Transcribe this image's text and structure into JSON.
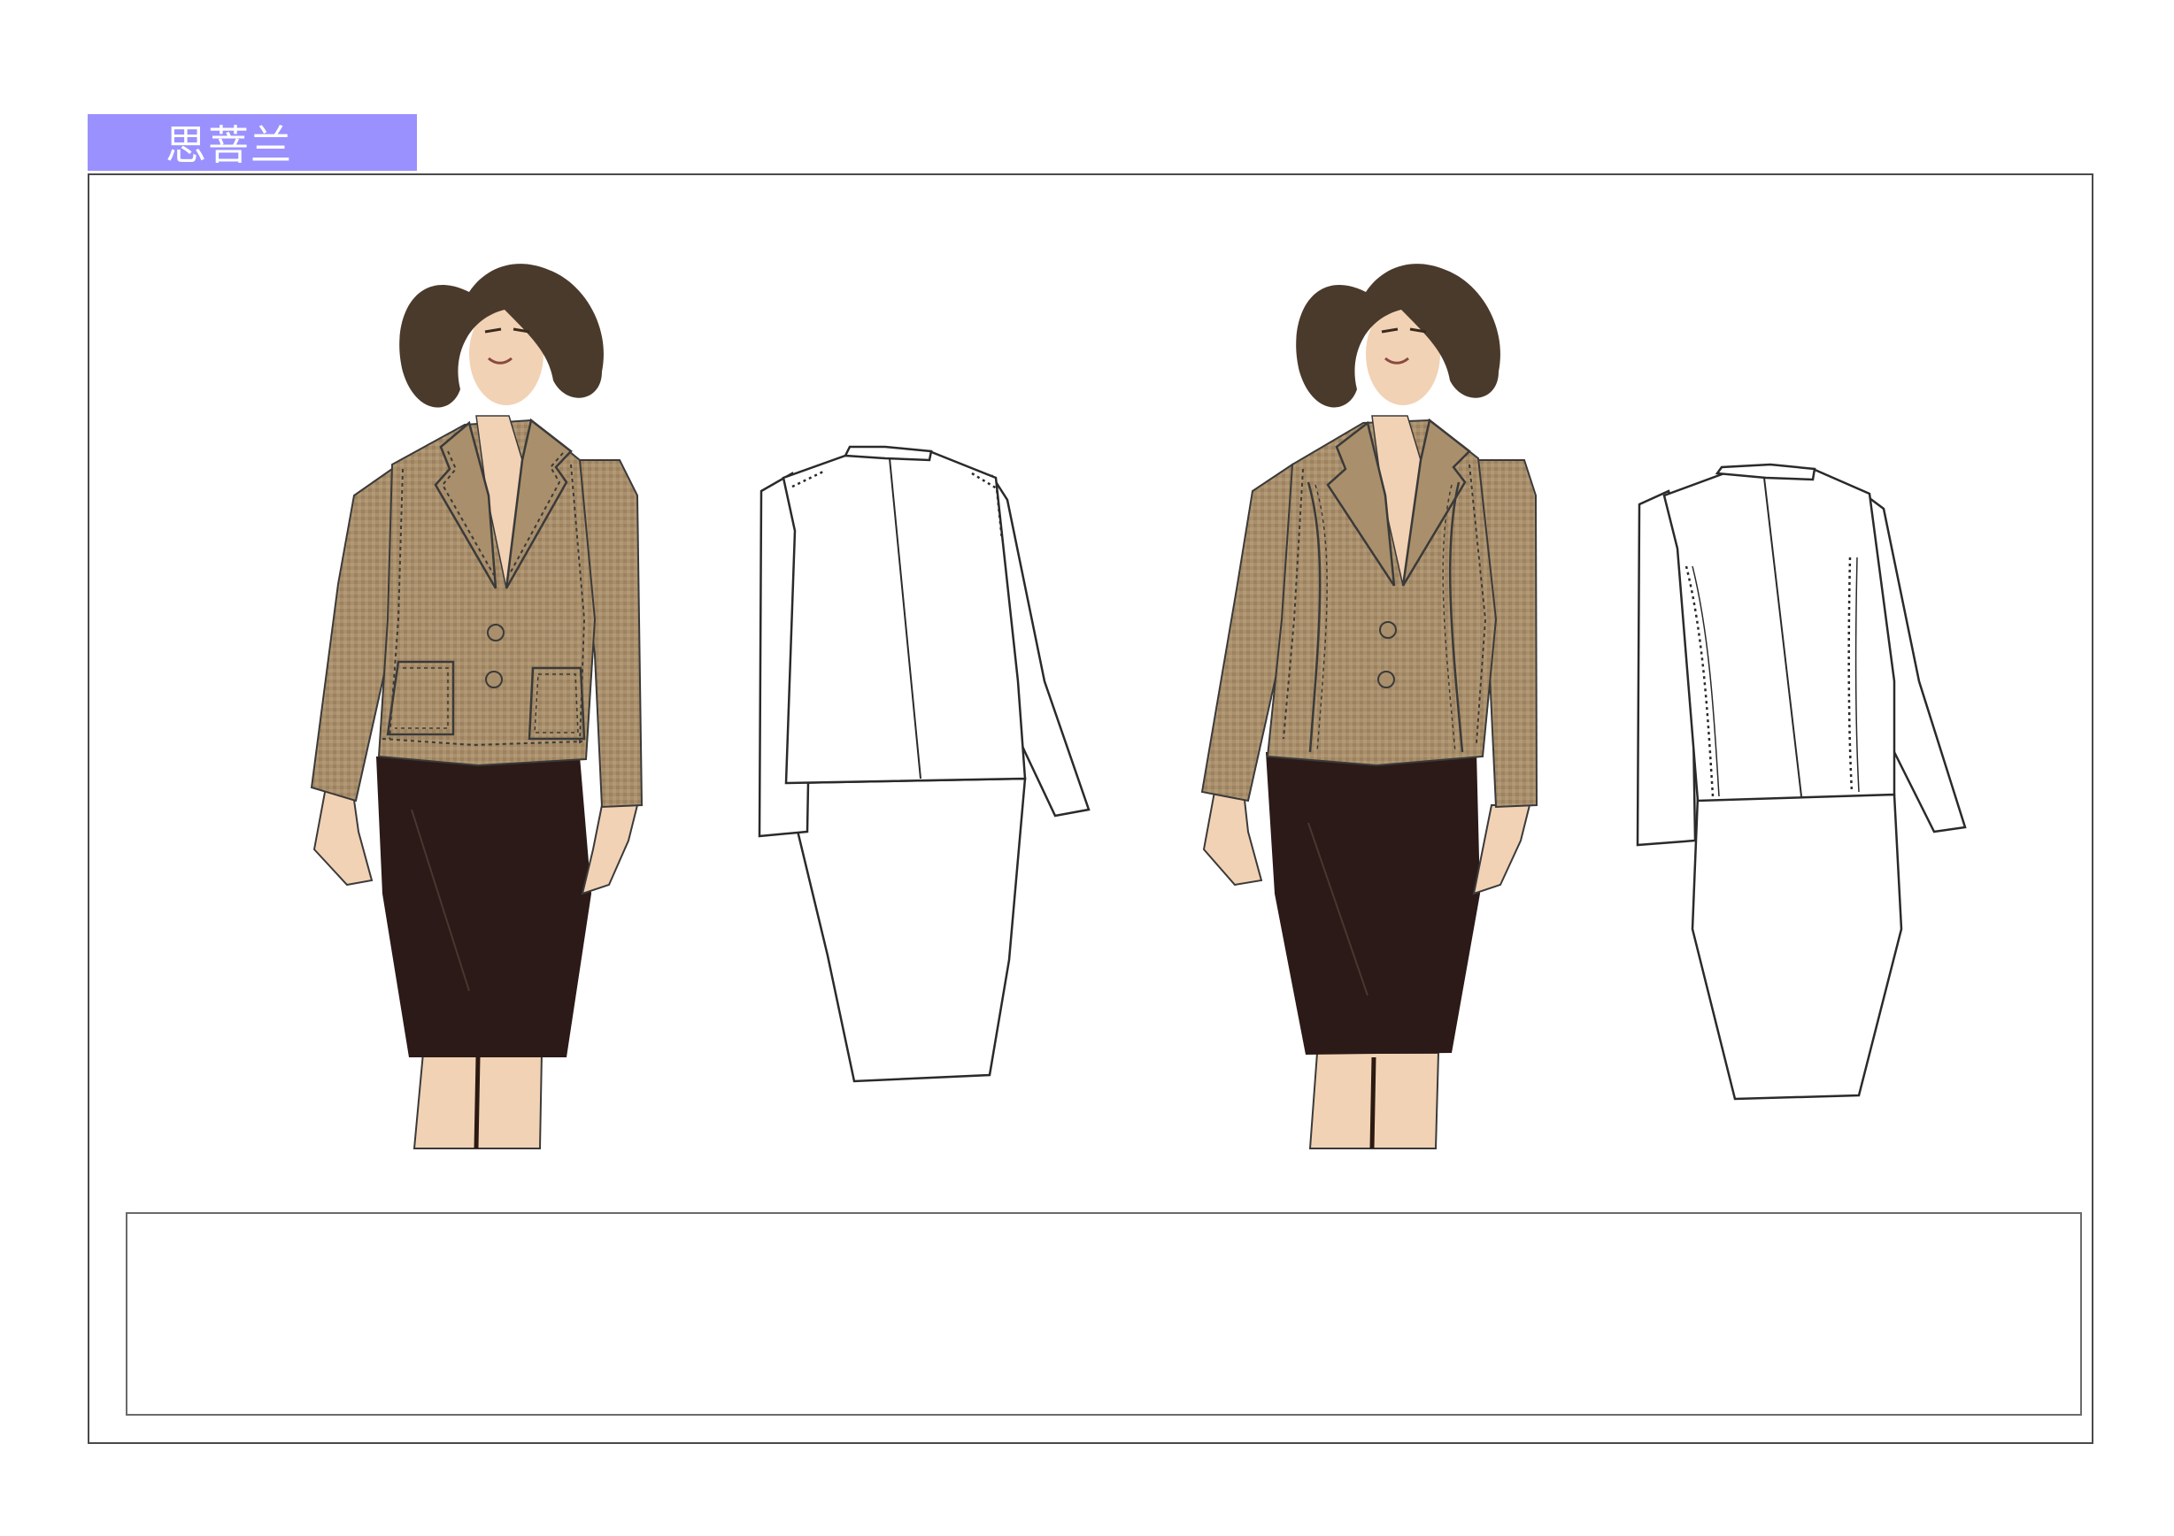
{
  "header": {
    "brand_label": "思菩兰"
  },
  "colors": {
    "brand_tab": "#9a91ff",
    "jacket": "#a98f6b",
    "jacket_dark": "#6e5a41",
    "skirt": "#2b1a17",
    "hair": "#4a3a2c",
    "skin": "#f2d2b4",
    "outline": "#3a3a3a"
  },
  "figures": [
    {
      "view": "front",
      "variant": "patch-pocket-jacket"
    },
    {
      "view": "back",
      "variant": "flat-sketch"
    },
    {
      "view": "front",
      "variant": "princess-seam-jacket"
    },
    {
      "view": "back",
      "variant": "flat-sketch"
    }
  ]
}
